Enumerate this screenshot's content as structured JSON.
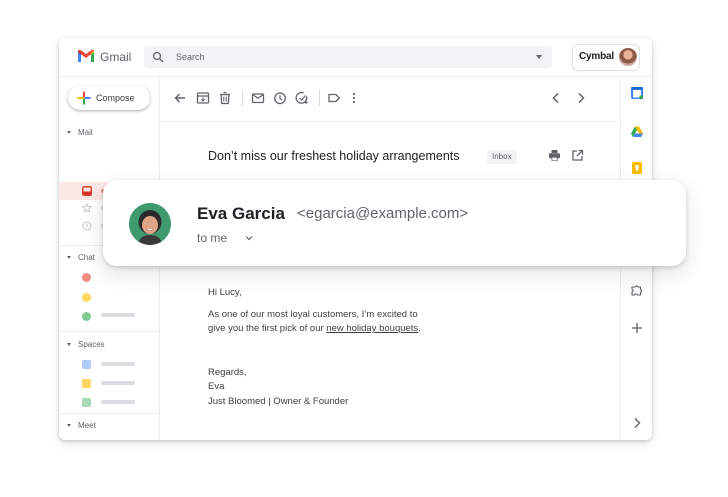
{
  "app": {
    "brand": "Gmail"
  },
  "search": {
    "placeholder": "Search"
  },
  "account": {
    "org_name": "Cymbal"
  },
  "compose": {
    "label": "Compose"
  },
  "sections": {
    "mail": "Mail",
    "chat": "Chat",
    "spaces": "Spaces",
    "meet": "Meet"
  },
  "email": {
    "subject": "Don’t miss our freshest holiday arrangements",
    "label": "Inbox",
    "sender_name": "Eva Garcia",
    "sender_email": "<egarcia@example.com>",
    "recipient": "to me",
    "greeting": "Hi Lucy,",
    "body_line1": "As one of our most loyal customers, I’m excited to",
    "body_line2_prefix": "give you the first pick of our ",
    "body_line2_link": "new holiday bouquets",
    "body_line2_suffix": ".",
    "signoff": "Regards,",
    "signature_name": "Eva",
    "signature_title": "Just Bloomed | Owner & Founder"
  },
  "colors": {
    "gmail_red": "#ea4335",
    "google_blue": "#4285f4",
    "google_green": "#34a853",
    "google_yellow": "#fbbc04",
    "active_nav_bg": "#fce8e6",
    "avatar_green": "#3f9b6d"
  },
  "icons": {
    "toolbar": [
      "back-arrow-icon",
      "archive-icon",
      "delete-icon",
      "mark-unread-icon",
      "snooze-icon",
      "add-task-icon",
      "label-icon",
      "more-vert-icon",
      "prev-icon",
      "next-icon"
    ],
    "right_rail": [
      "calendar-icon",
      "drive-icon",
      "keep-icon",
      "addons-icon",
      "add-icon",
      "expand-icon"
    ]
  }
}
